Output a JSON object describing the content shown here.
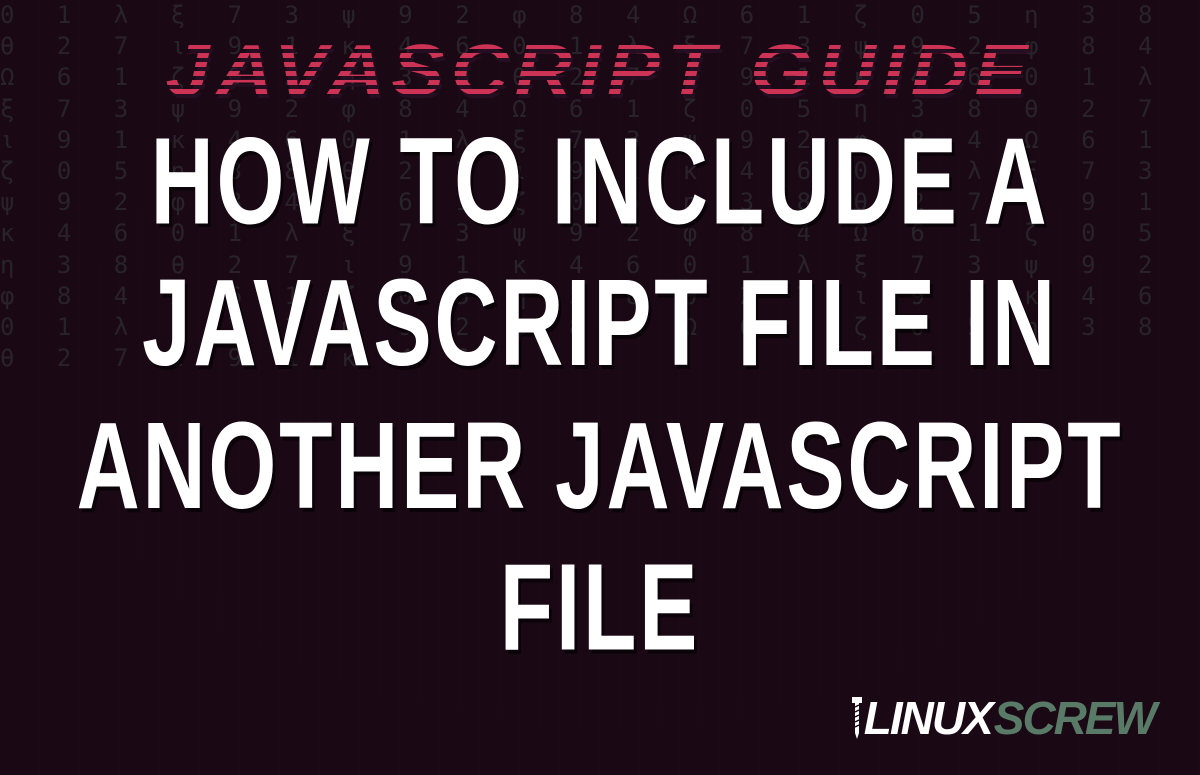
{
  "subtitle": "JAVASCRIPT GUIDE",
  "main_title": "HOW TO INCLUDE A JAVASCRIPT FILE IN ANOTHER JAVASCRIPT FILE",
  "logo": {
    "part1": "LINUX",
    "part2": "SCREW"
  },
  "matrix_filler": "0 1 λ ξ 7 3 ψ 9 2 φ 8 4 Ω 6 1 ζ 0 5 η 3 8 θ 2 7 ι 9 1 κ 4 6 0 1 λ ξ 7 3 ψ 9 2 φ 8 4 Ω 6 1 ζ 0 5 η 3 8 θ 2 7 ι 9 1 κ 4 6 0 1 λ ξ 7 3 ψ 9 2 φ 8 4 Ω 6 1 ζ 0 5 η 3 8 θ 2 7 ι 9 1 κ 4 6 0 1 λ ξ 7 3 ψ 9 2 φ 8 4 Ω 6 1 ζ 0 5 η 3 8 θ 2 7 ι 9 1 κ 4 6 0 1 λ ξ 7 3 ψ 9 2 φ 8 4 Ω 6 1 ζ 0 5 η 3 8 θ 2 7 ι 9 1 κ 4 6 0 1 λ ξ 7 3 ψ 9 2 φ 8 4 Ω 6 1 ζ 0 5 η 3 8 θ 2 7 ι 9 1 κ 4 6 0 1 λ ξ 7 3 ψ 9 2 φ 8 4 Ω 6 1 ζ 0 5 η 3 8 θ 2 7 ι 9 1 κ 4 6 0 1 λ ξ 7 3 ψ 9 2 φ 8 4 Ω 6 1 ζ 0 5 η 3 8 θ 2 7 ι 9 1 κ 4 6"
}
